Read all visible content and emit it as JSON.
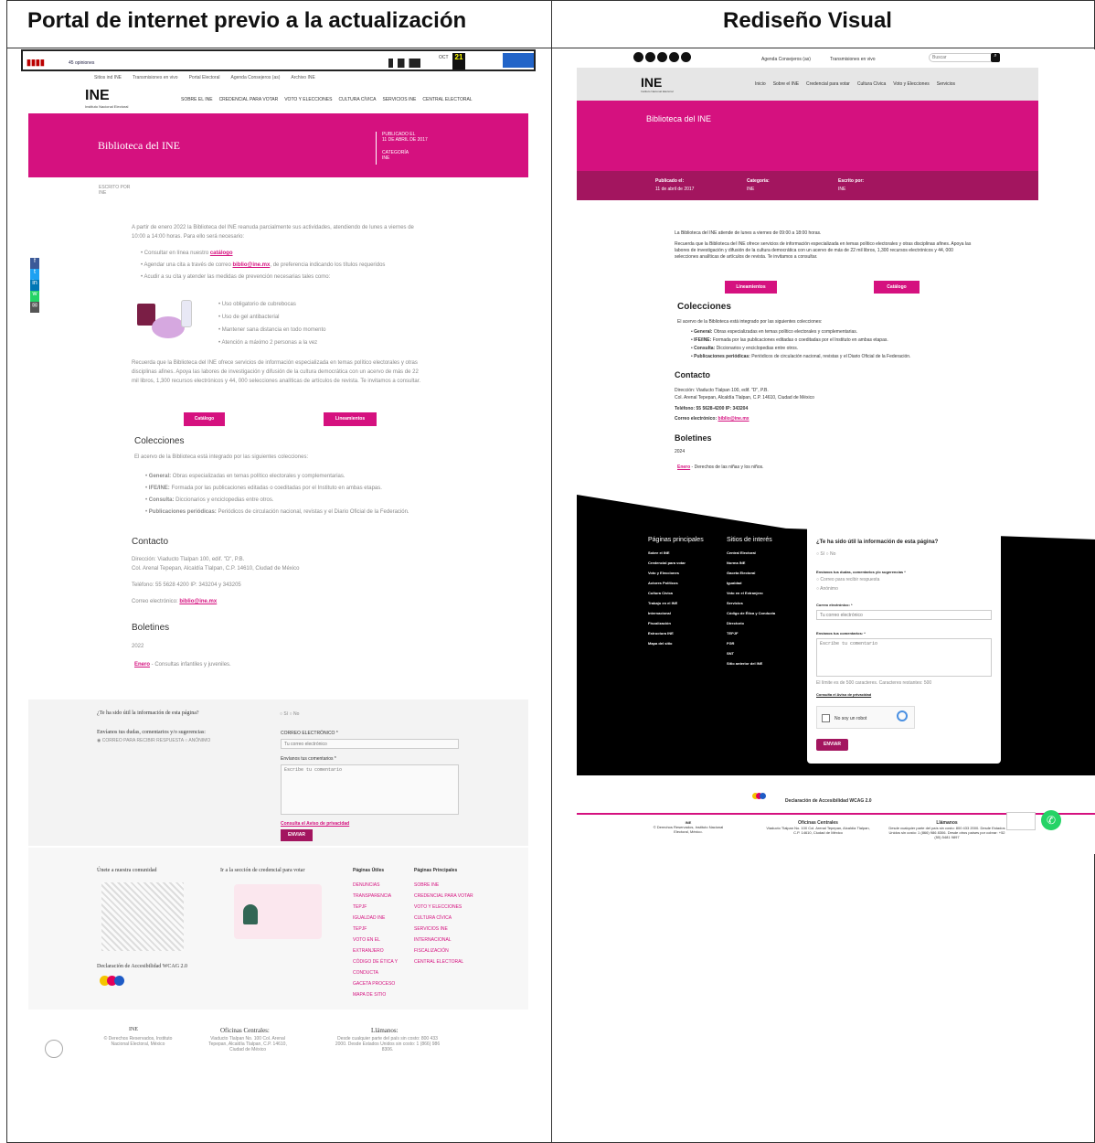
{
  "headers": {
    "left": "Portal de internet previo a la actualización",
    "right": "Rediseño Visual"
  },
  "colors": {
    "brand": "#d5117f",
    "dark_pink": "#a3155f",
    "black": "#000000",
    "gray": "#e6e6e6"
  },
  "left": {
    "news_strip": {
      "label": "45 opiniones",
      "date_badge": "21",
      "month": "OCT"
    },
    "top_links": [
      "Sitios ind INE",
      "Transmisiones en vivo",
      "Portal Electoral",
      "Agenda Consejeros (as)",
      "Archivo INE"
    ],
    "brand": {
      "logo": "INE",
      "subtitle": "Instituto Nacional Electoral"
    },
    "nav": [
      "SOBRE EL INE",
      "CREDENCIAL PARA VOTAR",
      "VOTO Y ELECCIONES",
      "CULTURA CÍVICA",
      "SERVICIOS INE",
      "CENTRAL ELECTORAL"
    ],
    "banner": {
      "title": "Biblioteca del INE",
      "published_label": "PUBLICADO EL",
      "published_date": "11 DE ABRIL DE 2017",
      "category_label": "CATEGORÍA",
      "category": "INE"
    },
    "written_label": "ESCRITO POR",
    "written_value": "INE",
    "intro": "A partir de enero 2022 la Biblioteca del INE reanuda parcialmente sus actividades, atendiendo de lunes a viernes de 10:00 a 14:00 horas. Para ello será necesario:",
    "bullets": [
      {
        "text": "Consultar en línea nuestro ",
        "link": "catálogo"
      },
      {
        "text": "Agendar una cita a través de correo ",
        "link": "biblio@ine.mx",
        "after": ", de preferencia indicando los títulos requeridos"
      },
      {
        "text": "Acudir a su cita y atender las medidas de prevención necesarias tales como:"
      }
    ],
    "measures": [
      "Uso obligatorio de cubrebocas",
      "Uso de gel antibacterial",
      "Mantener sana distancia en todo momento",
      "Atención a máximo 2 personas a la vez"
    ],
    "recall": "Recuerda que la Biblioteca del INE ofrece servicios de información especializada en temas político electorales y otras disciplinas afines. Apoya las labores de investigación y difusión de la cultura democrática con un acervo de más de 22 mil libros, 1,300 recursos electrónicos y 44, 000 selecciones analíticas de artículos de revista. Te invitamos a consultar.",
    "buttons": [
      "Catálogo",
      "Lineamientos"
    ],
    "colecciones_title": "Colecciones",
    "colecciones_intro": "El acervo de la Biblioteca está integrado por las siguientes colecciones:",
    "colecciones": [
      {
        "b": "General:",
        "t": " Obras especializadas en temas político electorales y complementarias."
      },
      {
        "b": "IFE/INE:",
        "t": " Formada por las publicaciones editadas o coeditadas por el Instituto en ambas etapas."
      },
      {
        "b": "Consulta:",
        "t": " Diccionarios y enciclopedias entre otros."
      },
      {
        "b": "Publicaciones periódicas:",
        "t": " Periódicos de circulación nacional, revistas y el Diario Oficial de la Federación."
      }
    ],
    "contacto_title": "Contacto",
    "direccion": "Dirección: Viaducto Tlalpan 100, edif. \"D\", P.B.",
    "direccion2": "Col. Arenal Tepepan, Alcaldía Tlalpan, C.P. 14610, Ciudad de México",
    "telefono": "Teléfono: 55 5628 4200 IP: 343204 y 343205",
    "correo_label": "Correo electrónico: ",
    "correo": "biblio@ine.mx",
    "boletines_title": "Boletines",
    "boletines_year": "2022",
    "boletin_link": "Enero",
    "boletin_text": " - Consultas infantiles y juveniles.",
    "feedback": {
      "question": "¿Te ha sido útil la información de esta página?",
      "si": "Sí",
      "no": "No",
      "send_label": "Envíanos tus dudas, comentarios y/o sugerencias:",
      "opt1": "CORREO PARA RECIBIR RESPUESTA",
      "opt2": "ANÓNIMO",
      "email_label": "CORREO ELECTRÓNICO *",
      "email_placeholder": "Tu correo electrónico",
      "comment_label": "Envíanos tus comentarios *",
      "comment_placeholder": "Escribe tu comentario",
      "privacy": "Consulta el Aviso de privacidad",
      "submit": "ENVIAR"
    },
    "footer": {
      "community": "Únete a nuestra comunidad",
      "credencial": "Ir a la sección de credencial para votar",
      "accesibilidad": "Declaración de Accesibilidad WCAG 2.0",
      "col1_title": "Páginas Útiles",
      "col1": [
        "DENUNCIAS",
        "TRANSPARENCIA",
        "TEPJF",
        "IGUALDAD INE",
        "TEPJF",
        "VOTO EN EL EXTRANJERO",
        "CÓDIGO DE ÉTICA Y CONDUCTA",
        "GACETA PROCESO",
        "MAPA DE SITIO"
      ],
      "col2_title": "Páginas Principales",
      "col2": [
        "SOBRE INE",
        "CREDENCIAL PARA VOTAR",
        "VOTO Y ELECCIONES",
        "CULTURA CÍVICA",
        "SERVICIOS INE",
        "INTERNACIONAL",
        "FISCALIZACIÓN",
        "CENTRAL ELECTORAL"
      ],
      "ine_title": "INE",
      "ine_text": "© Derechos Reservados, Instituto Nacional Electoral, México",
      "oficinas_title": "Oficinas Centrales:",
      "oficinas_text": "Viaducto Tlalpan No. 100 Col. Arenal Tepepan, Alcaldía Tlalpan, C.P. 14610, Ciudad de México",
      "llamanos_title": "Llámanos:",
      "llamanos_text": "Desde cualquier parte del país sin costo: 800 433 2000. Desde Estados Unidos sin costo: 1 (866) 986 8306."
    }
  },
  "right": {
    "top": {
      "agenda": "Agenda Consejeros (as)",
      "transmisiones": "Transmisiones en vivo",
      "search_placeholder": "Buscar"
    },
    "brand": {
      "logo": "INE",
      "subtitle": "Instituto Nacional Electoral"
    },
    "nav": [
      "Inicio",
      "Sobre el INE",
      "Credencial para votar",
      "Cultura Cívica",
      "Voto y Elecciones",
      "Servicios"
    ],
    "banner": {
      "title": "Biblioteca del INE",
      "published_label": "Publicado el:",
      "published_date": "11 de abril de 2017",
      "category_label": "Categoría:",
      "category": "INE",
      "written_label": "Escrito por:",
      "written_value": "INE"
    },
    "intro1": "La Biblioteca del INE atiende de lunes a viernes de 09:00 a 18:00 horas.",
    "intro2": "Recuerda que la Biblioteca del INE ofrece servicios de información especializada en temas político electorales y otras disciplinas afines. Apoya las labores de investigación y difusión de la cultura democrática con un acervo de más de 22 mil libros, 1,300 recursos electrónicos y 44, 000 selecciones analíticas de artículos de revista. Te invitamos a consultar.",
    "buttons": [
      "Lineamientos",
      "Catálogo"
    ],
    "colecciones_title": "Colecciones",
    "colecciones_intro": "El acervo de la Biblioteca está integrado por las siguientes colecciones:",
    "colecciones": [
      {
        "b": "General:",
        "t": " Obras especializadas en temas político electorales y complementarias."
      },
      {
        "b": "IFE/INE:",
        "t": " Formada por las publicaciones editadas o coeditadas por el Instituto en ambas etapas."
      },
      {
        "b": "Consulta:",
        "t": " Diccionarios y enciclopedias entre otros."
      },
      {
        "b": "Publicaciones periódicas:",
        "t": " Periódicos de circulación nacional, revistas y el Diario Oficial de la Federación."
      }
    ],
    "contacto_title": "Contacto",
    "direccion": "Dirección: Viaducto Tlalpan 100, edif. \"D\", P.B.",
    "direccion2": "Col. Arenal Tepepan, Alcaldía Tlalpan, C.P. 14610, Ciudad de México",
    "telefono": "Teléfono: 55 5628-4200 IP: 343204",
    "correo_label": "Correo electrónico: ",
    "correo": "biblio@ine.mx",
    "boletines_title": "Boletines",
    "boletines_year": "2024",
    "boletin_link": "Enero",
    "boletin_text": " - Derechos de las niñas y los niños.",
    "footer": {
      "col1_title": "Páginas principales",
      "col1": [
        "Sobre el INE",
        "Credencial para votar",
        "Voto y Elecciones",
        "Actores Políticos",
        "Cultura Cívica",
        "Trabajo en el INE",
        "Internacional",
        "Fiscalización",
        "Estructura INE",
        "Mapa del sitio"
      ],
      "col2_title": "Sitios de interés",
      "col2": [
        "Central Electoral",
        "Norma INE",
        "Gaceta Electoral",
        "Igualdad",
        "Voto en el Extranjero",
        "Servicios",
        "Código de Ética y Conducta",
        "Directorio",
        "TEPJF",
        "FGR",
        "SNT",
        "Sitio anterior del INE"
      ],
      "form": {
        "question": "¿Te ha sido útil la información de esta página?",
        "si": "Sí",
        "no": "No",
        "send_label": "Envíanos tus dudas, comentarios y/o sugerencias *",
        "opt1": "Correo para recibir respuesta",
        "opt2": "Anónimo",
        "email_label": "Correo electrónico: *",
        "email_placeholder": "Tu correo electrónico",
        "comment_label": "Envíanos tus comentarios: *",
        "comment_placeholder": "Escribe tu comentario",
        "limit": "El límite es de 500 caracteres. Caracteres restantes: 500",
        "privacy": "Consulta el Aviso de privacidad",
        "captcha": "No soy un robot",
        "submit": "ENVIAR"
      }
    },
    "accesibilidad": "Declaración de Accesibilidad WCAG 2.0",
    "bottom": {
      "ine_title": "INE",
      "ine_text": "© Derechos Reservados, Instituto Nacional Electoral, México.",
      "oficinas_title": "Oficinas Centrales",
      "oficinas_text": "Viaducto Tlalpan No. 100 Col. Arenal Tepepan, Alcaldía Tlalpan, C.P. 14610, Ciudad de México",
      "llamanos_title": "Llámanos",
      "llamanos_text": "Desde cualquier parte del país sin costo: 800 433 2000. Desde Estados Unidos sin costo: 1 (866) 986 8306. Desde otros países por cobrar: +52 (55) 5481 9897"
    }
  }
}
